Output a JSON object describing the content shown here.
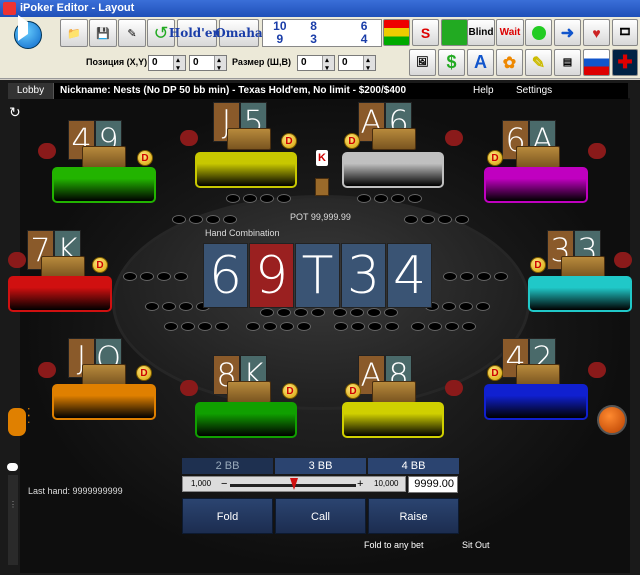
{
  "window": {
    "title": "iPoker Editor  -  Layout"
  },
  "toolbar": {
    "holdem_label": "Hold'em",
    "omaha_label": "Omaha",
    "numbers": [
      "10",
      "8",
      "6",
      "9",
      "3",
      "4"
    ],
    "blind_label": "Blind",
    "wait_label": "Wait",
    "position_label": "Позиция (X,Y)",
    "size_label": "Размер (Ш,В)",
    "pos_x": "0",
    "pos_y": "0",
    "size_w": "0",
    "size_h": "0"
  },
  "menu": {
    "lobby": "Lobby",
    "nickname": "Nickname: Nests (No DP 50 bb min) - Texas Hold'em, No limit - $200/$400",
    "help": "Help",
    "settings": "Settings"
  },
  "table": {
    "pot": "POT 99,999.99",
    "hand_combination": "Hand Combination",
    "board": [
      "6",
      "9",
      "T",
      "3",
      "4"
    ],
    "last_hand": "Last hand: 9999999999",
    "fold_to_any": "Fold to any bet",
    "sit_out": "Sit Out"
  },
  "seats": [
    {
      "cards": [
        "4",
        "9"
      ],
      "color": "#22b400"
    },
    {
      "cards": [
        "J",
        "5"
      ],
      "color": "#c8c800"
    },
    {
      "cards": [
        "A",
        "6"
      ],
      "color": "#c0c0c0"
    },
    {
      "cards": [
        "6",
        "A"
      ],
      "color": "#c000c0"
    },
    {
      "cards": [
        "7",
        "K"
      ],
      "color": "#d01010"
    },
    {
      "cards": [
        "3",
        "3"
      ],
      "color": "#20c8c8"
    },
    {
      "cards": [
        "J",
        "Q"
      ],
      "color": "#e08000"
    },
    {
      "cards": [
        "8",
        "K"
      ],
      "color": "#10a000"
    },
    {
      "cards": [
        "A",
        "8"
      ],
      "color": "#d0d000"
    },
    {
      "cards": [
        "4",
        "2"
      ],
      "color": "#1020d0"
    }
  ],
  "betting": {
    "bb_buttons": [
      "2 BB",
      "3 BB",
      "4 BB"
    ],
    "min": "1,000",
    "max": "10,000",
    "amount": "9999.00",
    "fold": "Fold",
    "call": "Call",
    "raise": "Raise"
  }
}
